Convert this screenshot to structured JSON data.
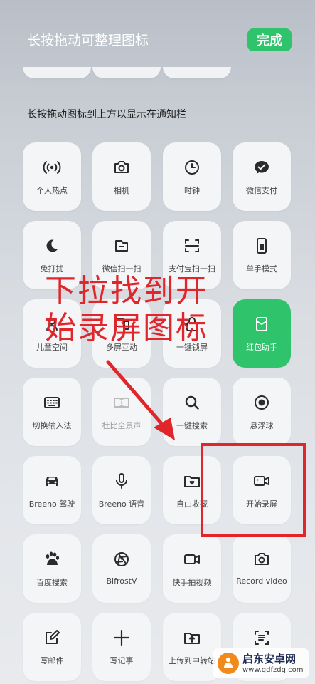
{
  "header": {
    "title": "长按拖动可整理图标",
    "done_label": "完成"
  },
  "hint": "长按拖动图标到上方以显示在通知栏",
  "tiles": [
    {
      "label": "个人热点"
    },
    {
      "label": "相机"
    },
    {
      "label": "时钟"
    },
    {
      "label": "微信支付"
    },
    {
      "label": "免打扰"
    },
    {
      "label": "微信扫一扫"
    },
    {
      "label": "支付宝扫一扫"
    },
    {
      "label": "单手模式"
    },
    {
      "label": "儿童空间"
    },
    {
      "label": "多屏互动"
    },
    {
      "label": "一键锁屏"
    },
    {
      "label": "红包助手"
    },
    {
      "label": "切换输入法"
    },
    {
      "label": "杜比全景声"
    },
    {
      "label": "一键搜索"
    },
    {
      "label": "悬浮球"
    },
    {
      "label": "Breeno 驾驶"
    },
    {
      "label": "Breeno 语音"
    },
    {
      "label": "自由收藏"
    },
    {
      "label": "开始录屏"
    },
    {
      "label": "百度搜索"
    },
    {
      "label": "BifrostV"
    },
    {
      "label": "快手拍视频"
    },
    {
      "label": "Record video"
    },
    {
      "label": "写邮件"
    },
    {
      "label": "写记事"
    },
    {
      "label": "上传到中转站"
    },
    {
      "label": ""
    }
  ],
  "annotation": {
    "line1": "下拉找到开",
    "line2": "始录屏图标"
  },
  "watermark": {
    "title": "启东安卓网",
    "url": "www.qdfzdq.com"
  },
  "colors": {
    "accent": "#2fc36b",
    "annotation": "#e0262b"
  }
}
